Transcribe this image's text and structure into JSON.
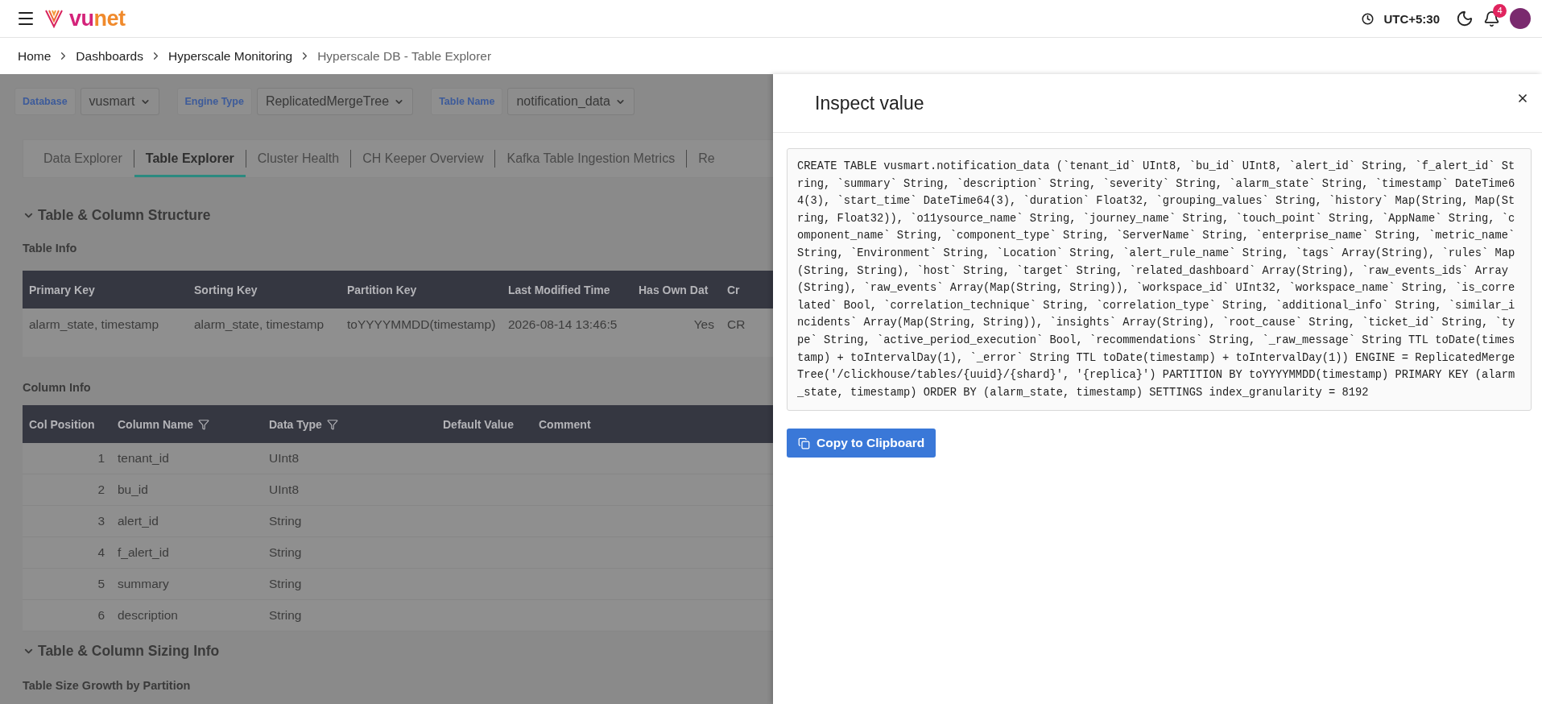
{
  "header": {
    "logo": {
      "part_1": "vu",
      "part_2": "net"
    },
    "timezone": "UTC+5:30",
    "notifications": {
      "count": "4"
    }
  },
  "breadcrumb": [
    {
      "label": "Home",
      "current": false
    },
    {
      "label": "Dashboards",
      "current": false
    },
    {
      "label": "Hyperscale Monitoring",
      "current": false
    },
    {
      "label": "Hyperscale DB - Table Explorer",
      "current": true
    }
  ],
  "filters": [
    {
      "label": "Database",
      "value": "vusmart"
    },
    {
      "label": "Engine Type",
      "value": "ReplicatedMergeTree"
    },
    {
      "label": "Table Name",
      "value": "notification_data"
    }
  ],
  "tabs": [
    {
      "label": "Data Explorer",
      "selected": false
    },
    {
      "label": "Table Explorer",
      "selected": true
    },
    {
      "label": "Cluster Health",
      "selected": false
    },
    {
      "label": "CH Keeper Overview",
      "selected": false
    },
    {
      "label": "Kafka Table Ingestion Metrics",
      "selected": false
    },
    {
      "label": "Re",
      "selected": false
    }
  ],
  "structure_section": {
    "title": "Table & Column Structure",
    "expanded": true,
    "table_info": {
      "title": "Table Info",
      "columns": [
        "Primary Key",
        "Sorting Key",
        "Partition Key",
        "Last Modified Time",
        "Has Own Dat",
        "Cr"
      ],
      "rows": [
        [
          "alarm_state, timestamp",
          "alarm_state, timestamp",
          "toYYYYMMDD(timestamp)",
          "2026-08-14 13:46:5",
          "Yes",
          "CR"
        ]
      ]
    },
    "column_info": {
      "title": "Column Info",
      "columns": [
        {
          "label": "Col Position",
          "filterable": false
        },
        {
          "label": "Column Name",
          "filterable": true
        },
        {
          "label": "Data Type",
          "filterable": true
        },
        {
          "label": "Default Value",
          "filterable": false
        },
        {
          "label": "Comment",
          "filterable": false
        }
      ],
      "rows": [
        [
          "1",
          "tenant_id",
          "UInt8",
          "",
          ""
        ],
        [
          "2",
          "bu_id",
          "UInt8",
          "",
          ""
        ],
        [
          "3",
          "alert_id",
          "String",
          "",
          ""
        ],
        [
          "4",
          "f_alert_id",
          "String",
          "",
          ""
        ],
        [
          "5",
          "summary",
          "String",
          "",
          ""
        ],
        [
          "6",
          "description",
          "String",
          "",
          ""
        ]
      ]
    }
  },
  "sizing_section": {
    "title": "Table & Column Sizing Info",
    "expanded": true,
    "subtitle": "Table Size Growth by Partition"
  },
  "drawer": {
    "title": "Inspect value",
    "code": "CREATE TABLE vusmart.notification_data (`tenant_id` UInt8, `bu_id` UInt8, `alert_id` String, `f_alert_id` String, `summary` String, `description` String, `severity` String, `alarm_state` String, `timestamp` DateTime64(3), `start_time` DateTime64(3), `duration` Float32, `grouping_values` String, `history` Map(String, Map(String, Float32)), `o11ysource_name` String, `journey_name` String, `touch_point` String, `AppName` String, `component_name` String, `component_type` String, `ServerName` String, `enterprise_name` String, `metric_name` String, `Environment` String, `Location` String, `alert_rule_name` String, `tags` Array(String), `rules` Map(String, String), `host` String, `target` String, `related_dashboard` Array(String), `raw_events_ids` Array(String), `raw_events` Array(Map(String, String)), `workspace_id` UInt32, `workspace_name` String, `is_correlated` Bool, `correlation_technique` String, `correlation_type` String, `additional_info` String, `similar_incidents` Array(Map(String, String)), `insights` Array(String), `root_cause` String, `ticket_id` String, `type` String, `active_period_execution` Bool, `recommendations` String, `_raw_message` String TTL toDate(timestamp) + toIntervalDay(1), `_error` String TTL toDate(timestamp) + toIntervalDay(1)) ENGINE = ReplicatedMergeTree('/clickhouse/tables/{uuid}/{shard}', '{replica}') PARTITION BY toYYYYMMDD(timestamp) PRIMARY KEY (alarm_state, timestamp) ORDER BY (alarm_state, timestamp) SETTINGS index_granularity = 8192",
    "button": "Copy to Clipboard"
  }
}
